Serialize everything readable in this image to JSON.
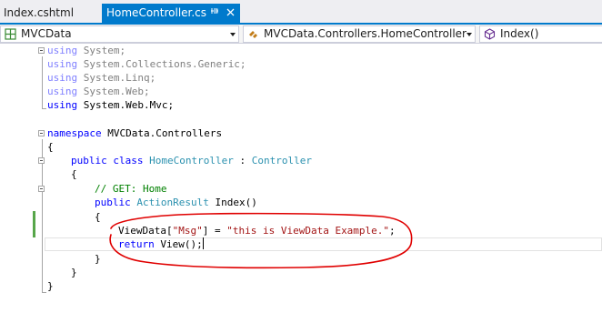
{
  "tabs": [
    {
      "label": "Index.cshtml",
      "active": false
    },
    {
      "label": "HomeController.cs",
      "active": true
    }
  ],
  "tab_icons": {
    "pin": "pin-icon",
    "close": "close-icon"
  },
  "navbar": {
    "project": "MVCData",
    "class": "MVCData.Controllers.HomeController",
    "member": "Index()"
  },
  "code": {
    "line1": [
      "using",
      " System;"
    ],
    "line2": [
      "using",
      " System.Collections.Generic;"
    ],
    "line3": [
      "using",
      " System.Linq;"
    ],
    "line4": [
      "using",
      " System.Web;"
    ],
    "line5": [
      "using",
      " System.Web.Mvc;"
    ],
    "line7": [
      "namespace",
      " MVCData.Controllers"
    ],
    "line8": "{",
    "line9": [
      "public",
      " ",
      "class",
      " ",
      "HomeController",
      " : ",
      "Controller"
    ],
    "line10": "{",
    "line11": "// GET: Home",
    "line12": [
      "public",
      " ",
      "ActionResult",
      " Index()"
    ],
    "line13": "{",
    "line14": [
      "ViewData[",
      "\"Msg\"",
      "] = ",
      "\"this is ViewData Example.\"",
      ";"
    ],
    "line15": [
      "return",
      " View();"
    ],
    "line16": "}",
    "line17": "}",
    "line18": "}"
  },
  "colors": {
    "accent": "#007acc",
    "keyword": "#0000ff",
    "type": "#2b91af",
    "string": "#a31515",
    "comment": "#008000",
    "annotation": "#e00000",
    "change_marker": "#57a64a"
  }
}
